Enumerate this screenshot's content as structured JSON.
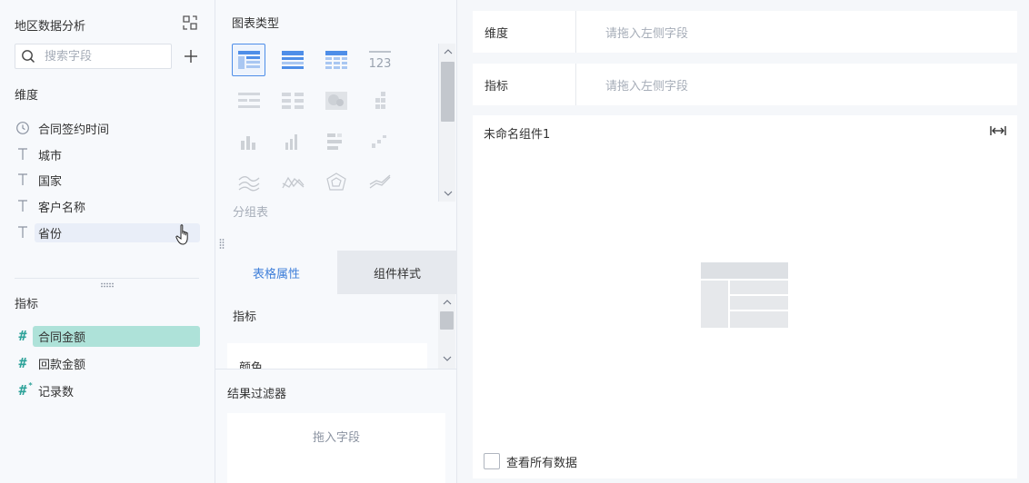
{
  "left": {
    "title": "地区数据分析",
    "search_placeholder": "搜索字段",
    "dimension_label": "维度",
    "dimensions": [
      {
        "label": "合同签约时间",
        "icon": "clock-icon"
      },
      {
        "label": "城市",
        "icon": "text-type-icon"
      },
      {
        "label": "国家",
        "icon": "text-type-icon"
      },
      {
        "label": "客户名称",
        "icon": "text-type-icon"
      },
      {
        "label": "省份",
        "icon": "text-type-icon"
      }
    ],
    "metric_label": "指标",
    "metrics": [
      {
        "label": "合同金额",
        "icon": "number-type-icon"
      },
      {
        "label": "回款金额",
        "icon": "number-type-icon"
      },
      {
        "label": "记录数",
        "icon": "number-calc-icon"
      }
    ]
  },
  "middle": {
    "title": "图表类型",
    "selected_chart_name": "分组表",
    "tabs": [
      {
        "label": "表格属性",
        "active": true
      },
      {
        "label": "组件样式",
        "active": false
      }
    ],
    "props_label": "指标",
    "props_color_label": "颜色",
    "filter_label": "结果过滤器",
    "filter_drop_text": "拖入字段"
  },
  "right": {
    "dimension_row": {
      "label": "维度",
      "placeholder": "请拖入左侧字段"
    },
    "metric_row": {
      "label": "指标",
      "placeholder": "请拖入左侧字段"
    },
    "widget_title": "未命名组件1",
    "view_all_label": "查看所有数据"
  },
  "colors": {
    "accent": "#3f7fd9",
    "metric_green": "#2fa39a",
    "metric_selected_bg": "#aee2d9"
  }
}
